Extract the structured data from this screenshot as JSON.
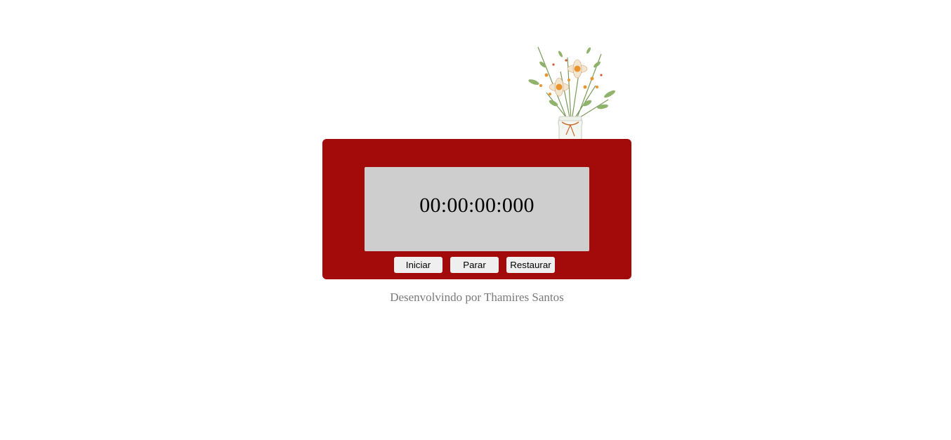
{
  "colors": {
    "panel": "#a30a0a",
    "display": "#cecece",
    "button": "#efefef",
    "credit_text": "#7a7a7a"
  },
  "stopwatch": {
    "time": "00:00:00:000"
  },
  "buttons": {
    "start_label": "Iniciar",
    "stop_label": "Parar",
    "reset_label": "Restaurar"
  },
  "decoration": {
    "icon": "flower-vase-illustration"
  },
  "footer": {
    "credit": "Desenvolvindo por Thamires Santos"
  }
}
